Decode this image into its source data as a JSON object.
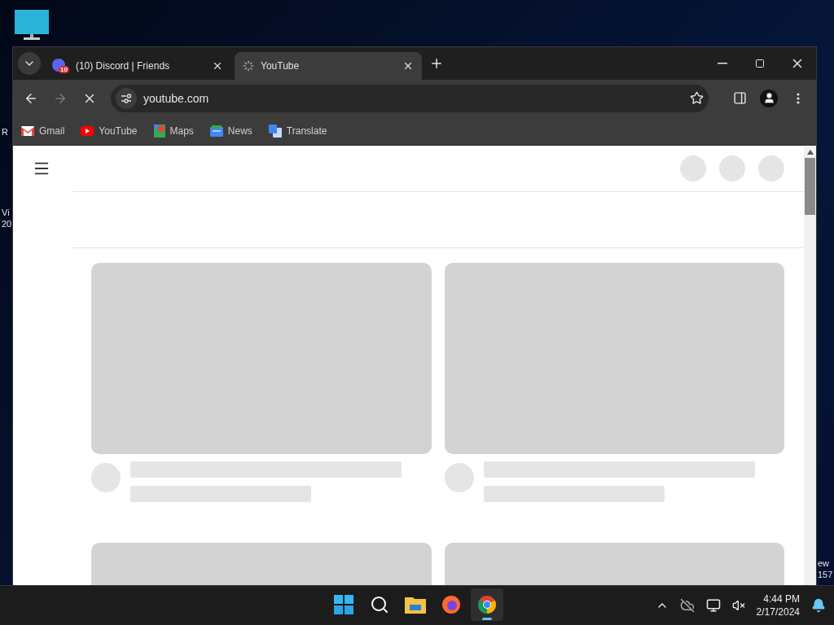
{
  "desktop": {
    "left_fragments": [
      "R",
      "Vi",
      "20"
    ],
    "right_fragments": [
      "ew",
      "157"
    ]
  },
  "browser": {
    "tabs": [
      {
        "title": "(10) Discord | Friends",
        "badge": "10",
        "selected": false,
        "loading": false
      },
      {
        "title": "YouTube",
        "selected": true,
        "loading": true
      }
    ],
    "address": "youtube.com",
    "loading": true,
    "bookmarks": [
      {
        "label": "Gmail",
        "kind": "gmail"
      },
      {
        "label": "YouTube",
        "kind": "youtube"
      },
      {
        "label": "Maps",
        "kind": "maps"
      },
      {
        "label": "News",
        "kind": "news"
      },
      {
        "label": "Translate",
        "kind": "translate"
      }
    ]
  },
  "taskbar": {
    "apps": [
      {
        "kind": "start",
        "selected": false
      },
      {
        "kind": "search",
        "selected": false
      },
      {
        "kind": "files",
        "selected": false
      },
      {
        "kind": "firefox",
        "selected": false
      },
      {
        "kind": "chrome",
        "selected": true
      }
    ],
    "time": "4:44 PM",
    "date": "2/17/2024"
  }
}
